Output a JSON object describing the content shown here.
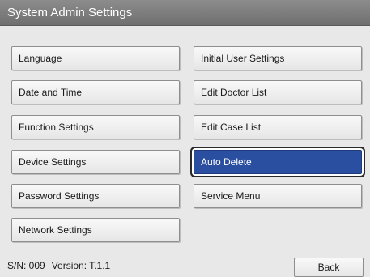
{
  "window": {
    "title": "System Admin Settings"
  },
  "left_menu": [
    {
      "label": "Language"
    },
    {
      "label": "Date and Time"
    },
    {
      "label": "Function Settings"
    },
    {
      "label": "Device Settings"
    },
    {
      "label": "Password Settings"
    },
    {
      "label": "Network Settings"
    }
  ],
  "right_menu": [
    {
      "label": "Initial User Settings"
    },
    {
      "label": "Edit Doctor List"
    },
    {
      "label": "Edit Case List"
    },
    {
      "label": "Auto Delete",
      "selected": true
    },
    {
      "label": "Service Menu"
    }
  ],
  "footer": {
    "serial": "S/N: 009",
    "version": "Version: T.1.1",
    "back_label": "Back"
  },
  "colors": {
    "selected_background": "#2a4ea0",
    "titlebar": "#7d7d7d",
    "window_background": "#e8e8e8"
  }
}
